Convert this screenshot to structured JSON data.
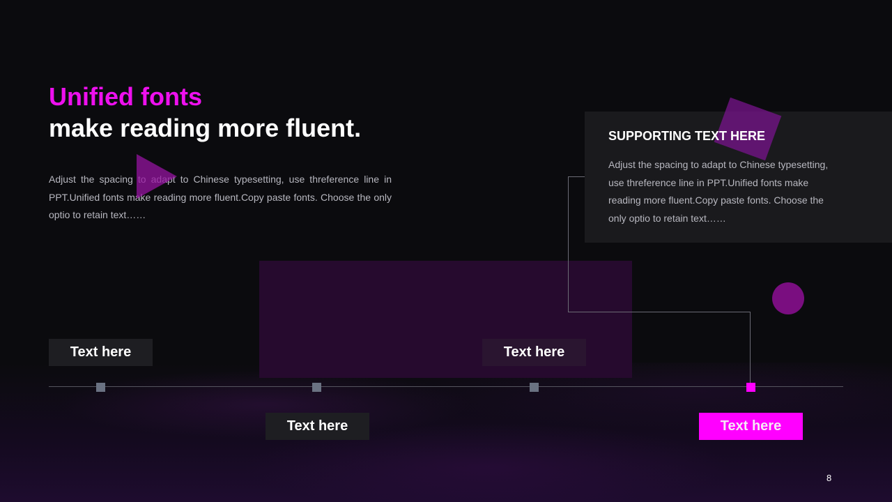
{
  "heading": {
    "accent": "Unified fonts",
    "main": "make reading more fluent."
  },
  "intro": {
    "text": "Adjust the spacing to adapt to Chinese typesetting, use threference line in PPT.Unified fonts make reading more fluent.Copy paste fonts. Choose the only optio to retain text……"
  },
  "support": {
    "title": "SUPPORTING TEXT HERE",
    "text": "Adjust the spacing to adapt to Chinese typesetting, use threference line in PPT.Unified fonts make reading more fluent.Copy paste fonts. Choose the only optio to retain text……"
  },
  "timeline": {
    "labels": [
      "Text here",
      "Text here",
      "Text here",
      "Text here"
    ],
    "active_index": 3
  },
  "colors": {
    "accent": "#ff00ff",
    "background": "#0b0b0e",
    "panel": "#1a1a1d"
  },
  "page_number": "8"
}
